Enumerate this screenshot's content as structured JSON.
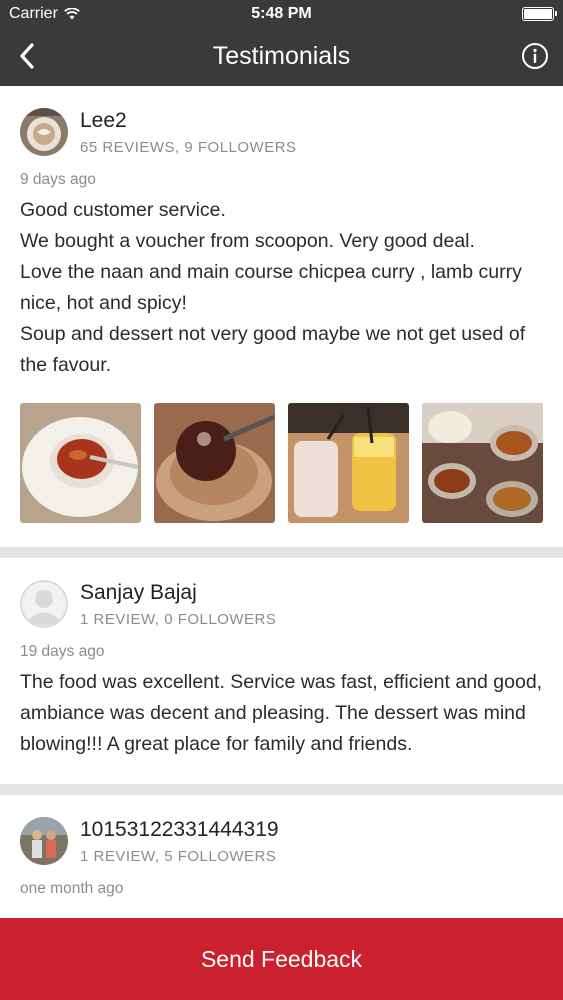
{
  "status_bar": {
    "carrier": "Carrier",
    "time": "5:48 PM",
    "icons": [
      "wifi-icon",
      "battery-icon"
    ]
  },
  "nav": {
    "title": "Testimonials",
    "back_icon": "chevron-left-icon",
    "info_icon": "info-icon"
  },
  "reviews": [
    {
      "name": "Lee2",
      "stats": "65 REVIEWS, 9 FOLLOWERS",
      "date": "9 days ago",
      "lines": [
        "Good customer service.",
        "We bought a voucher from scoopon. Very good deal.",
        "Love the naan and main course chicpea curry , lamb curry nice, hot and spicy!",
        "Soup and dessert not very good maybe we not get used of the favour."
      ]
    },
    {
      "name": "Sanjay Bajaj",
      "stats": "1 REVIEW, 0 FOLLOWERS",
      "date": "19 days ago",
      "lines": [
        "The food was excellent. Service was fast, efficient and good, ambiance was decent and pleasing. The dessert was mind blowing!!! A great place for family and friends."
      ]
    },
    {
      "name": "10153122331444319",
      "stats": "1 REVIEW, 5 FOLLOWERS",
      "date": "one month ago"
    }
  ],
  "footer": {
    "button_label": "Send Feedback"
  },
  "colors": {
    "nav_background": "#3a3a3a",
    "accent_red": "#cb202d",
    "separator": "#e4e4e4",
    "muted_text": "#8c8c8c"
  }
}
